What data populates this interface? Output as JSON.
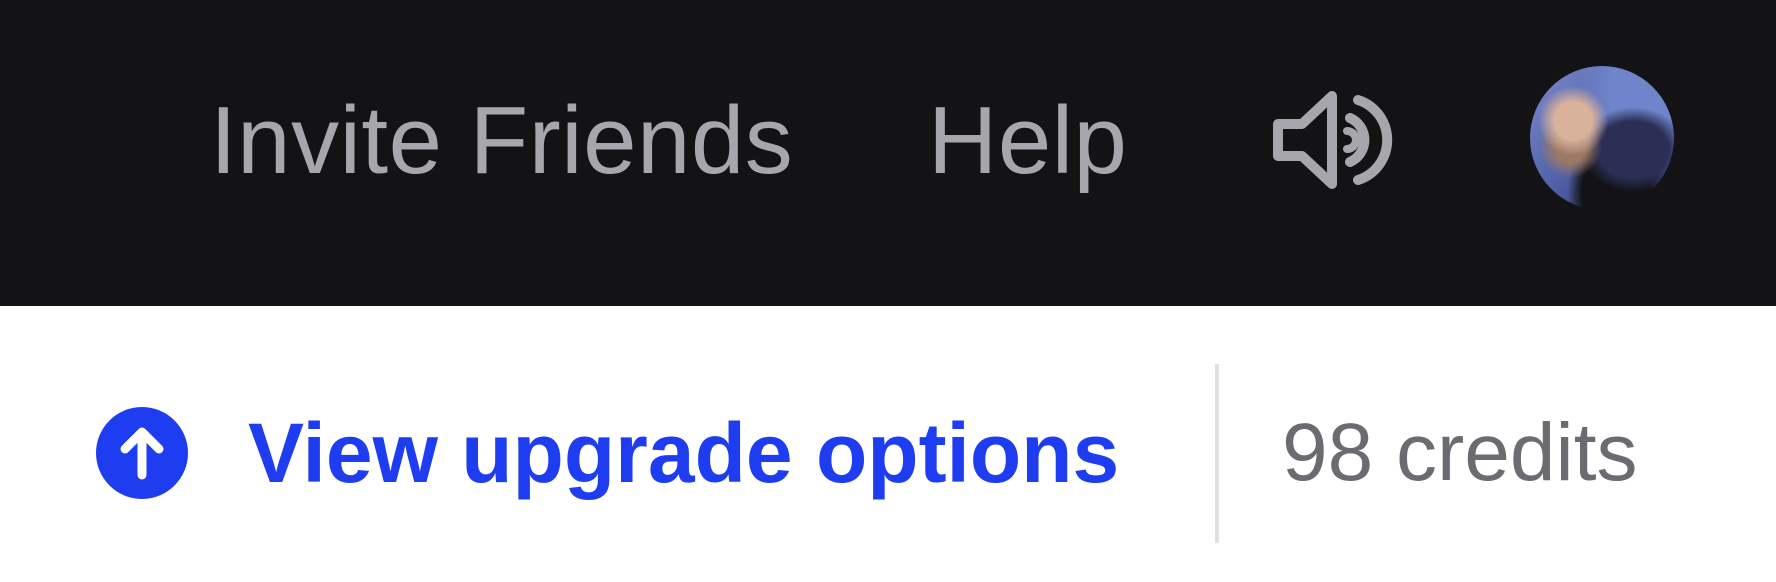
{
  "header": {
    "nav_links": {
      "invite_friends": "Invite Friends",
      "help": "Help"
    },
    "sound_icon": "speaker-with-sound-waves-icon",
    "avatar": "user-avatar-photo"
  },
  "upgrade_bar": {
    "upgrade_label": "View upgrade options",
    "upgrade_icon": "arrow-up-circle-icon",
    "credits_text": "98 credits"
  },
  "colors": {
    "header_bg": "#131315",
    "header_text": "#a6a6ad",
    "accent_blue": "#1f3df0",
    "muted_text": "#6b6c72",
    "divider": "#e1e1e4"
  }
}
